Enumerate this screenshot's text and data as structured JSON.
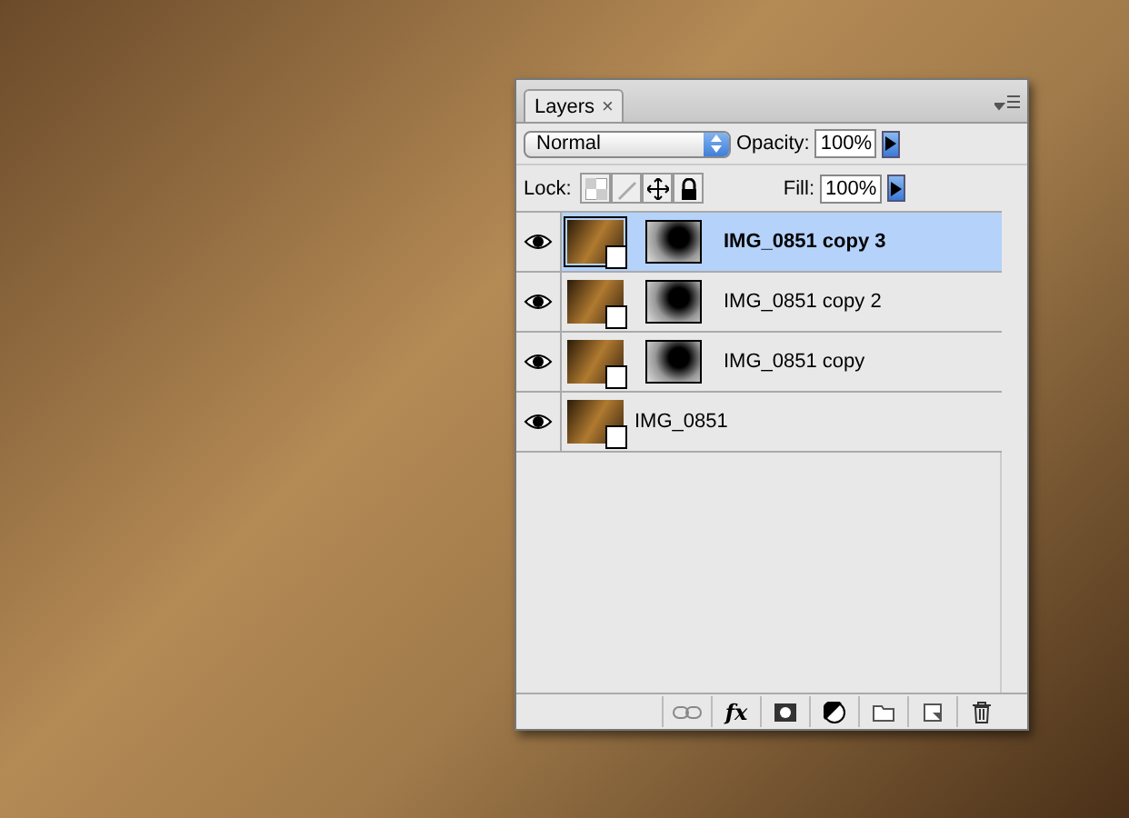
{
  "panel": {
    "tab": "Layers",
    "tab_close": "×"
  },
  "blend": {
    "mode": "Normal",
    "opacity_label": "Opacity:",
    "opacity": "100%"
  },
  "lock": {
    "label": "Lock:",
    "fill_label": "Fill:",
    "fill": "100%"
  },
  "layers": [
    {
      "name": "IMG_0851 copy 3",
      "selected": true,
      "visible": true,
      "has_mask": true
    },
    {
      "name": "IMG_0851 copy 2",
      "selected": false,
      "visible": true,
      "has_mask": true
    },
    {
      "name": "IMG_0851 copy",
      "selected": false,
      "visible": true,
      "has_mask": true
    },
    {
      "name": "IMG_0851",
      "selected": false,
      "visible": true,
      "has_mask": false
    }
  ],
  "toolbar": {
    "fx": "fx"
  }
}
